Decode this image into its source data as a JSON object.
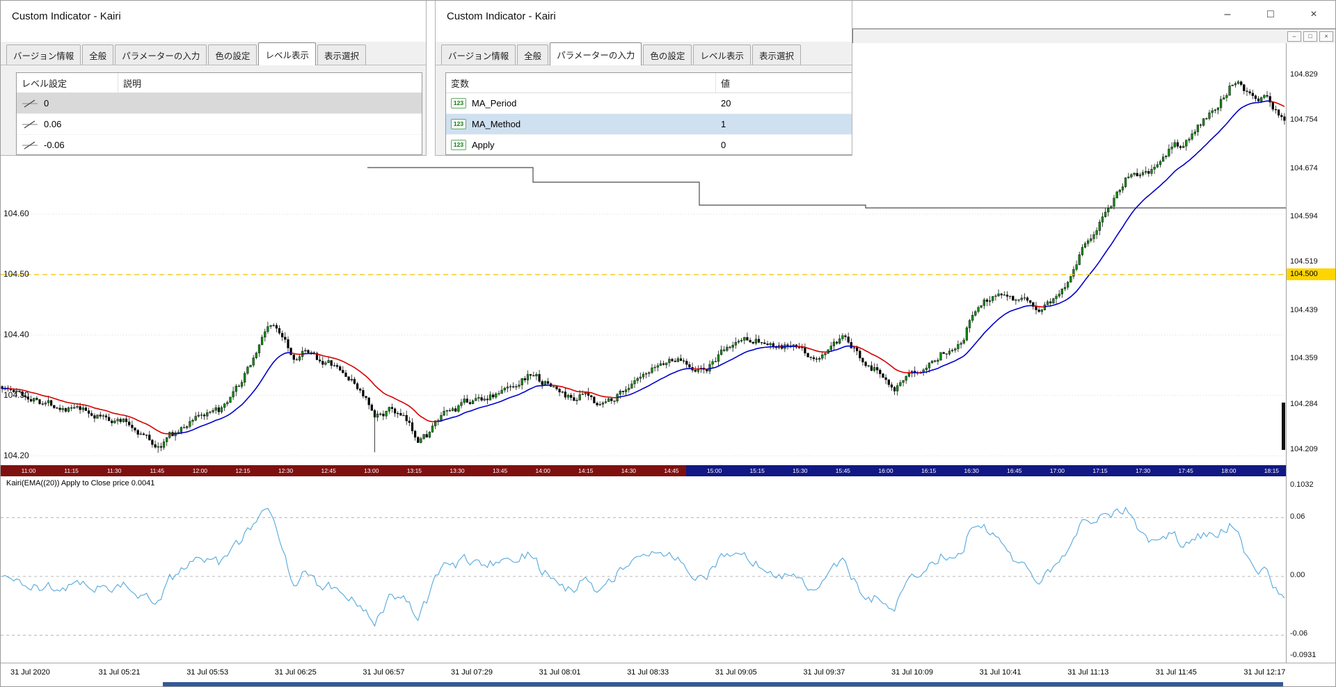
{
  "window": {
    "main_controls": {
      "minimize": "–",
      "restore": "□",
      "close": "×"
    },
    "chart_window_controls": {
      "minimize": "–",
      "restore": "□",
      "close": "×"
    }
  },
  "dialog_left": {
    "title": "Custom Indicator - Kairi",
    "tabs": [
      {
        "label": "バージョン情報",
        "active": false
      },
      {
        "label": "全般",
        "active": false
      },
      {
        "label": "パラメーターの入力",
        "active": false
      },
      {
        "label": "色の設定",
        "active": false
      },
      {
        "label": "レベル表示",
        "active": true
      },
      {
        "label": "表示選択",
        "active": false
      }
    ],
    "table": {
      "headers": [
        "レベル設定",
        "説明"
      ],
      "rows": [
        {
          "level": "0",
          "description": "",
          "selected": true
        },
        {
          "level": "0.06",
          "description": "",
          "selected": false
        },
        {
          "level": "-0.06",
          "description": "",
          "selected": false
        }
      ]
    }
  },
  "dialog_right": {
    "title": "Custom Indicator - Kairi",
    "icon_text": "123",
    "tabs": [
      {
        "label": "バージョン情報",
        "active": false
      },
      {
        "label": "全般",
        "active": false
      },
      {
        "label": "パラメーターの入力",
        "active": true
      },
      {
        "label": "色の設定",
        "active": false
      },
      {
        "label": "レベル表示",
        "active": false
      },
      {
        "label": "表示選択",
        "active": false
      }
    ],
    "table": {
      "headers": [
        "変数",
        "値"
      ],
      "rows": [
        {
          "name": "MA_Period",
          "value": "20",
          "selected": false
        },
        {
          "name": "MA_Method",
          "value": "1",
          "selected": true
        },
        {
          "name": "Apply",
          "value": "0",
          "selected": false
        }
      ]
    }
  },
  "colors": {
    "bull_candle": "#0a8f0a",
    "bear_candle": "#000000",
    "candle_stroke": "#111111",
    "ma_up": "#0000c8",
    "ma_down": "#d40000",
    "kairi_line": "#55a8dc",
    "level_line_yellow": "#f2c200",
    "grid_dotted": "#d9d9d9",
    "kairi_grid": "#b8b8b8",
    "badge_yellow": "#ffd400",
    "timebar_left": "#7f1010",
    "timebar_right": "#121884",
    "bottom_bar": "#31599b",
    "step_line": "#4a4a4a"
  },
  "chart_data": [
    {
      "type": "candlestick",
      "symbol_panel": "price",
      "right_axis_labels": [
        "104.829",
        "104.754",
        "104.674",
        "104.594",
        "104.519",
        "104.439",
        "104.359",
        "104.284",
        "104.209"
      ],
      "current_price": "104.500",
      "left_price_labels": [
        "104.60",
        "104.50",
        "104.40",
        "104.30",
        "104.20"
      ],
      "horizontal_line_price": 104.5,
      "x_time_labels": [
        "11:00",
        "11:15",
        "11:30",
        "11:45",
        "12:00",
        "12:15",
        "12:30",
        "12:45",
        "13:00",
        "13:15",
        "13:30",
        "13:45",
        "14:00",
        "14:15",
        "14:30",
        "14:45",
        "15:00",
        "15:15",
        "15:30",
        "15:45",
        "16:00",
        "16:15",
        "16:30",
        "16:45",
        "17:00",
        "17:15",
        "17:30",
        "17:45",
        "18:00",
        "18:15"
      ],
      "num_candles": 445,
      "ma": {
        "type": "EMA",
        "period": 20
      },
      "price_path": [
        [
          0.0,
          104.315
        ],
        [
          0.01,
          104.305
        ],
        [
          0.03,
          104.292
        ],
        [
          0.055,
          104.278
        ],
        [
          0.075,
          104.265
        ],
        [
          0.095,
          104.258
        ],
        [
          0.112,
          104.232
        ],
        [
          0.122,
          104.213
        ],
        [
          0.13,
          104.232
        ],
        [
          0.142,
          104.246
        ],
        [
          0.152,
          104.27
        ],
        [
          0.163,
          104.266
        ],
        [
          0.175,
          104.28
        ],
        [
          0.188,
          104.325
        ],
        [
          0.198,
          104.372
        ],
        [
          0.208,
          104.42
        ],
        [
          0.214,
          104.408
        ],
        [
          0.221,
          104.398
        ],
        [
          0.227,
          104.362
        ],
        [
          0.234,
          104.372
        ],
        [
          0.244,
          104.362
        ],
        [
          0.256,
          104.352
        ],
        [
          0.268,
          104.332
        ],
        [
          0.278,
          104.312
        ],
        [
          0.284,
          104.292
        ],
        [
          0.29,
          104.258
        ],
        [
          0.296,
          104.27
        ],
        [
          0.304,
          104.276
        ],
        [
          0.314,
          104.258
        ],
        [
          0.324,
          104.23
        ],
        [
          0.331,
          104.235
        ],
        [
          0.338,
          104.253
        ],
        [
          0.346,
          104.268
        ],
        [
          0.356,
          104.28
        ],
        [
          0.366,
          104.292
        ],
        [
          0.376,
          104.297
        ],
        [
          0.386,
          104.302
        ],
        [
          0.396,
          104.313
        ],
        [
          0.406,
          104.329
        ],
        [
          0.414,
          104.336
        ],
        [
          0.421,
          104.323
        ],
        [
          0.429,
          104.316
        ],
        [
          0.437,
          104.302
        ],
        [
          0.445,
          104.295
        ],
        [
          0.453,
          104.301
        ],
        [
          0.461,
          104.291
        ],
        [
          0.469,
          104.287
        ],
        [
          0.477,
          104.297
        ],
        [
          0.485,
          104.311
        ],
        [
          0.494,
          104.321
        ],
        [
          0.504,
          104.331
        ],
        [
          0.513,
          104.351
        ],
        [
          0.524,
          104.361
        ],
        [
          0.533,
          104.356
        ],
        [
          0.541,
          104.346
        ],
        [
          0.549,
          104.341
        ],
        [
          0.557,
          104.361
        ],
        [
          0.566,
          104.376
        ],
        [
          0.575,
          104.391
        ],
        [
          0.583,
          104.396
        ],
        [
          0.591,
          104.391
        ],
        [
          0.599,
          104.381
        ],
        [
          0.607,
          104.376
        ],
        [
          0.614,
          104.381
        ],
        [
          0.621,
          104.376
        ],
        [
          0.629,
          104.366
        ],
        [
          0.636,
          104.356
        ],
        [
          0.646,
          104.381
        ],
        [
          0.656,
          104.391
        ],
        [
          0.663,
          104.376
        ],
        [
          0.671,
          104.361
        ],
        [
          0.679,
          104.346
        ],
        [
          0.688,
          104.333
        ],
        [
          0.696,
          104.316
        ],
        [
          0.704,
          104.323
        ],
        [
          0.713,
          104.336
        ],
        [
          0.721,
          104.356
        ],
        [
          0.729,
          104.366
        ],
        [
          0.739,
          104.379
        ],
        [
          0.749,
          104.396
        ],
        [
          0.756,
          104.431
        ],
        [
          0.763,
          104.451
        ],
        [
          0.771,
          104.463
        ],
        [
          0.779,
          104.471
        ],
        [
          0.786,
          104.469
        ],
        [
          0.793,
          104.456
        ],
        [
          0.801,
          104.449
        ],
        [
          0.809,
          104.443
        ],
        [
          0.816,
          104.456
        ],
        [
          0.823,
          104.463
        ],
        [
          0.831,
          104.491
        ],
        [
          0.837,
          104.521
        ],
        [
          0.843,
          104.549
        ],
        [
          0.849,
          104.563
        ],
        [
          0.854,
          104.571
        ],
        [
          0.859,
          104.596
        ],
        [
          0.865,
          104.619
        ],
        [
          0.871,
          104.643
        ],
        [
          0.877,
          104.661
        ],
        [
          0.884,
          104.666
        ],
        [
          0.891,
          104.663
        ],
        [
          0.897,
          104.671
        ],
        [
          0.903,
          104.681
        ],
        [
          0.909,
          104.701
        ],
        [
          0.914,
          104.716
        ],
        [
          0.919,
          104.711
        ],
        [
          0.924,
          104.723
        ],
        [
          0.929,
          104.731
        ],
        [
          0.935,
          104.749
        ],
        [
          0.941,
          104.761
        ],
        [
          0.947,
          104.779
        ],
        [
          0.953,
          104.799
        ],
        [
          0.959,
          104.816
        ],
        [
          0.964,
          104.829
        ],
        [
          0.969,
          104.811
        ],
        [
          0.974,
          104.801
        ],
        [
          0.98,
          104.791
        ],
        [
          0.986,
          104.789
        ],
        [
          0.991,
          104.776
        ],
        [
          1.0,
          104.761
        ]
      ],
      "long_wicks": [
        [
          0.122,
          104.205
        ],
        [
          0.29,
          104.206
        ]
      ],
      "step_line": [
        [
          527,
          240
        ],
        [
          765,
          240
        ],
        [
          765,
          261
        ],
        [
          1004,
          261
        ],
        [
          1004,
          294
        ],
        [
          1243,
          294
        ],
        [
          1243,
          298
        ],
        [
          1847,
          298
        ]
      ]
    },
    {
      "type": "line",
      "name": "Kairi",
      "label": "Kairi(EMA((20)) Apply to Close price 0.0041",
      "last_value": "0.0041",
      "y_axis_labels": [
        "0.1032",
        "0.06",
        "0.00",
        "-0.06",
        "-0.0931"
      ],
      "gridlines": [
        0.06,
        0.0,
        -0.06
      ],
      "ylim": [
        -0.0931,
        0.1032
      ],
      "derivation": "kairi = 100 * (close - EMA20) / EMA20",
      "key_points": [
        [
          0.21,
          0.1032
        ],
        [
          0.293,
          -0.0931
        ],
        [
          0.52,
          0.05
        ],
        [
          0.89,
          0.103
        ],
        [
          1.0,
          0.0041
        ]
      ],
      "x_labels": [
        "31 Jul 2020",
        "31 Jul 05:21",
        "31 Jul 05:53",
        "31 Jul 06:25",
        "31 Jul 06:57",
        "31 Jul 07:29",
        "31 Jul 08:01",
        "31 Jul 08:33",
        "31 Jul 09:05",
        "31 Jul 09:37",
        "31 Jul 10:09",
        "31 Jul 10:41",
        "31 Jul 11:13",
        "31 Jul 11:45",
        "31 Jul 12:17"
      ]
    }
  ]
}
